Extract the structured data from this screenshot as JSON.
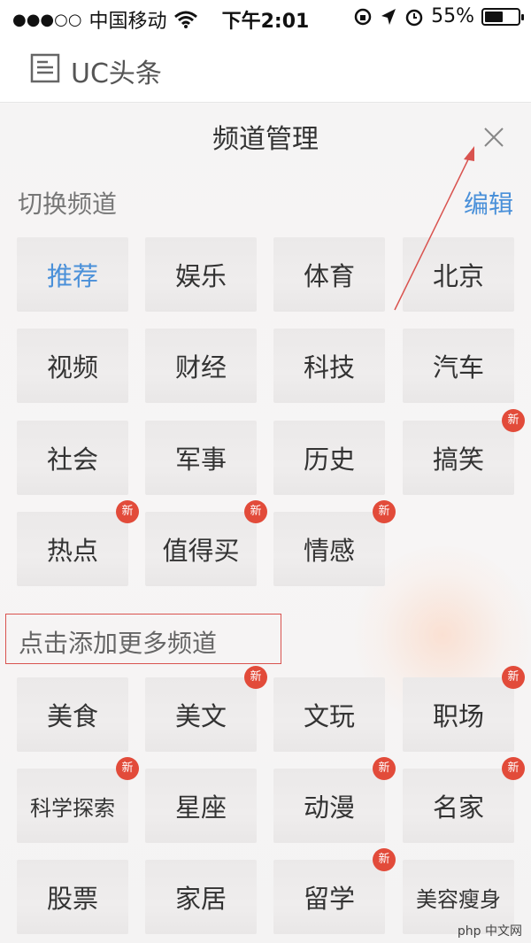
{
  "status_bar": {
    "signal": "●●●○○",
    "carrier": "中国移动",
    "time": "下午2:01",
    "battery": "55%",
    "battery_level": 0.55
  },
  "header": {
    "icon": "document-icon",
    "title": "UC头条"
  },
  "panel": {
    "title": "频道管理",
    "close_icon": "close-icon",
    "switch_label": "切换频道",
    "edit_label": "编辑",
    "add_label": "点击添加更多频道",
    "new_badge": "新",
    "my_channels": [
      {
        "label": "推荐",
        "active": true,
        "new": false
      },
      {
        "label": "娱乐",
        "active": false,
        "new": false
      },
      {
        "label": "体育",
        "active": false,
        "new": false
      },
      {
        "label": "北京",
        "active": false,
        "new": false
      },
      {
        "label": "视频",
        "active": false,
        "new": false
      },
      {
        "label": "财经",
        "active": false,
        "new": false
      },
      {
        "label": "科技",
        "active": false,
        "new": false
      },
      {
        "label": "汽车",
        "active": false,
        "new": false
      },
      {
        "label": "社会",
        "active": false,
        "new": false
      },
      {
        "label": "军事",
        "active": false,
        "new": false
      },
      {
        "label": "历史",
        "active": false,
        "new": false
      },
      {
        "label": "搞笑",
        "active": false,
        "new": true
      },
      {
        "label": "热点",
        "active": false,
        "new": true
      },
      {
        "label": "值得买",
        "active": false,
        "new": true
      },
      {
        "label": "情感",
        "active": false,
        "new": true
      }
    ],
    "more_channels": [
      {
        "label": "美食",
        "new": false
      },
      {
        "label": "美文",
        "new": true
      },
      {
        "label": "文玩",
        "new": false
      },
      {
        "label": "职场",
        "new": true
      },
      {
        "label": "科学探索",
        "new": true
      },
      {
        "label": "星座",
        "new": false
      },
      {
        "label": "动漫",
        "new": true
      },
      {
        "label": "名家",
        "new": true
      },
      {
        "label": "股票",
        "new": false
      },
      {
        "label": "家居",
        "new": false
      },
      {
        "label": "留学",
        "new": true
      },
      {
        "label": "美容瘦身",
        "new": false
      }
    ]
  },
  "colors": {
    "accent": "#4a90d9",
    "badge": "#e24b3a",
    "highlight_box": "#d9534f"
  },
  "watermark": "php 中文网"
}
